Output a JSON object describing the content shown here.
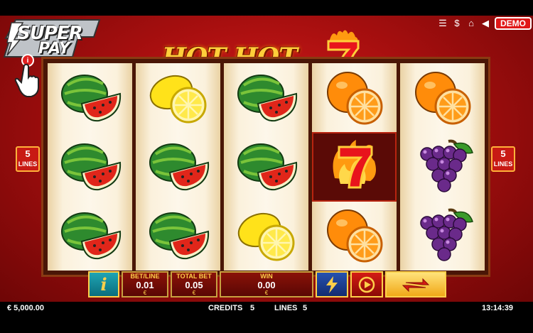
{
  "brand": {
    "line1": "SUPER",
    "line2": "PAY",
    "info_label": "i"
  },
  "title": {
    "text": "HOT HOT",
    "seven": "7"
  },
  "top_icons": [
    "menu-icon",
    "dollar-icon",
    "home-icon",
    "sound-icon"
  ],
  "demo_label": "DEMO",
  "lines_left": {
    "number": "5",
    "label": "LINES"
  },
  "lines_right": {
    "number": "5",
    "label": "LINES"
  },
  "reels": [
    [
      "watermelon",
      "watermelon",
      "watermelon"
    ],
    [
      "lemon",
      "watermelon",
      "watermelon"
    ],
    [
      "watermelon",
      "watermelon",
      "lemon"
    ],
    [
      "orange",
      "seven",
      "orange"
    ],
    [
      "orange",
      "grapes",
      "grapes"
    ]
  ],
  "controls": {
    "info_label": "i",
    "bet_line_label": "BET/LINE",
    "bet_line_value": "0.01",
    "bet_line_currency": "€",
    "total_bet_label": "TOTAL BET",
    "total_bet_value": "0.05",
    "total_bet_currency": "€",
    "win_label": "WIN",
    "win_value": "0.00",
    "win_currency": "€"
  },
  "status": {
    "balance": "€ 5,000.00",
    "credits_label": "CREDITS",
    "credits_value": "5",
    "lines_label": "LINES",
    "lines_value": "5",
    "clock": "13:14:39"
  },
  "colors": {
    "accent": "#ffd04a",
    "background": "#b81414",
    "demo": "#e01818"
  }
}
